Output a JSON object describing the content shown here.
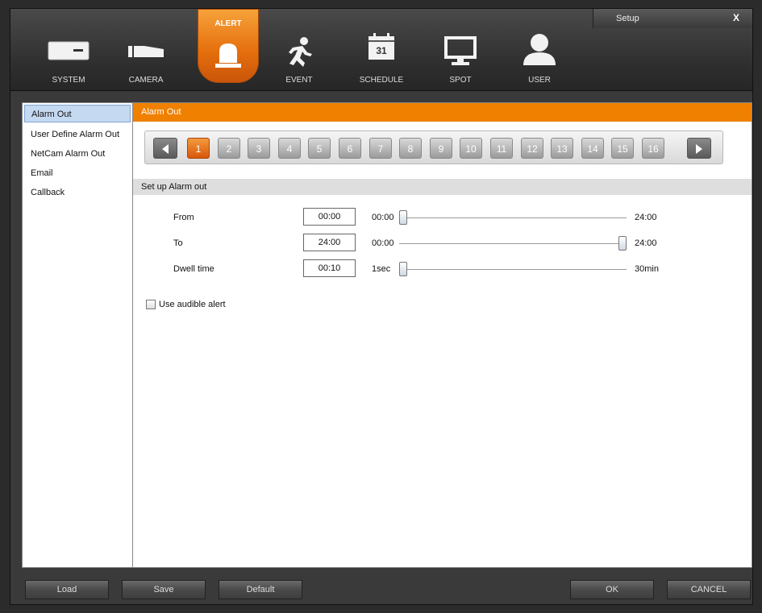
{
  "window": {
    "title": "Setup",
    "close_label": "X"
  },
  "tabs": [
    {
      "label": "SYSTEM",
      "icon": "system-box-icon"
    },
    {
      "label": "CAMERA",
      "icon": "camera-icon"
    },
    {
      "label": "ALERT",
      "icon": "alarm-light-icon",
      "active": true
    },
    {
      "label": "EVENT",
      "icon": "running-man-icon"
    },
    {
      "label": "SCHEDULE",
      "icon": "calendar-icon",
      "calendar_day": "31"
    },
    {
      "label": "SPOT",
      "icon": "monitor-icon"
    },
    {
      "label": "USER",
      "icon": "user-icon"
    }
  ],
  "sidebar": {
    "items": [
      {
        "label": "Alarm Out",
        "selected": true
      },
      {
        "label": "User Define Alarm Out"
      },
      {
        "label": "NetCam Alarm Out"
      },
      {
        "label": "Email"
      },
      {
        "label": "Callback"
      }
    ]
  },
  "main": {
    "header": "Alarm Out",
    "channels": [
      "1",
      "2",
      "3",
      "4",
      "5",
      "6",
      "7",
      "8",
      "9",
      "10",
      "11",
      "12",
      "13",
      "14",
      "15",
      "16"
    ],
    "active_channel": "1",
    "section_title": "Set up Alarm out",
    "rows": [
      {
        "label": "From",
        "value": "00:00",
        "min_label": "00:00",
        "max_label": "24:00",
        "level": 0.0
      },
      {
        "label": "To",
        "value": "24:00",
        "min_label": "00:00",
        "max_label": "24:00",
        "level": 1.0
      },
      {
        "label": "Dwell time",
        "value": "00:10",
        "min_label": "1sec",
        "max_label": "30min",
        "level": 0.0
      }
    ],
    "audible_alert": {
      "label": "Use audible alert",
      "checked": false
    }
  },
  "footer": {
    "load": "Load",
    "save": "Save",
    "default": "Default",
    "ok": "OK",
    "cancel": "CANCEL"
  },
  "colors": {
    "accent": "#f08000",
    "selected_nav": "#c5d9f1"
  }
}
